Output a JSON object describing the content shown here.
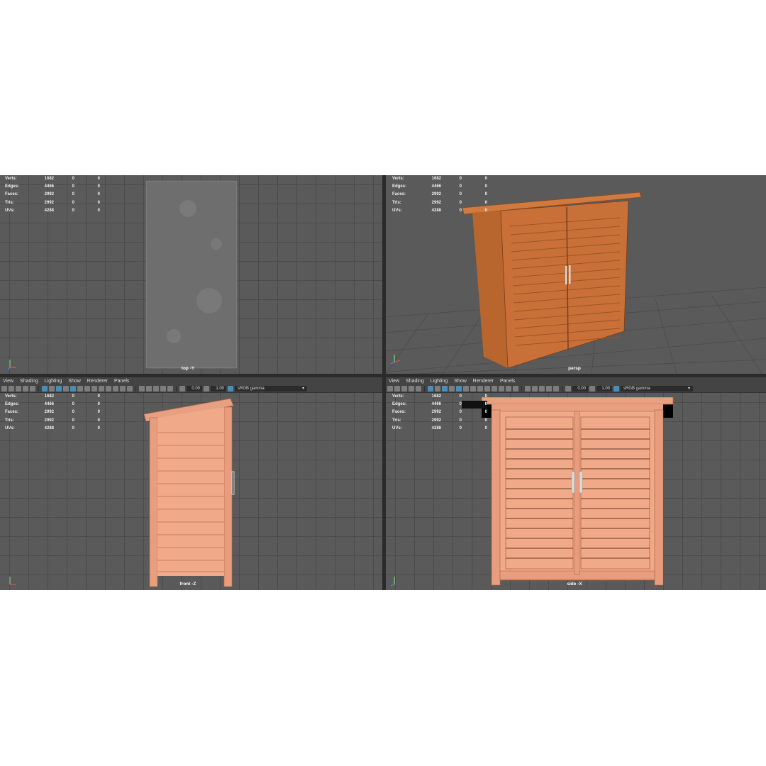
{
  "menu": [
    "View",
    "Shading",
    "Lighting",
    "Show",
    "Renderer",
    "Panels"
  ],
  "toolbar": {
    "exposure_value": "0.00",
    "gamma_value": "1.00",
    "color_space": "sRGB gamma",
    "icons": [
      "camera-icon",
      "camera-attr-icon",
      "bookmark-icon",
      "image-plane-icon",
      "grid-icon",
      "wireframe-icon",
      "smooth-shade-icon",
      "textured-icon",
      "lights-icon",
      "shadows-icon",
      "isolate-icon",
      "xray-icon",
      "exposure-icon",
      "gamma-icon",
      "color-space-icon"
    ]
  },
  "hud": {
    "labels": [
      "Verts:",
      "Edges:",
      "Faces:",
      "Tris:",
      "UVs:"
    ],
    "values": [
      [
        "1682",
        "0",
        "0"
      ],
      [
        "4466",
        "0",
        "0"
      ],
      [
        "2992",
        "0",
        "0"
      ],
      [
        "2992",
        "0",
        "0"
      ],
      [
        "4288",
        "0",
        "0"
      ]
    ]
  },
  "viewports": {
    "top": {
      "label": "top -Y"
    },
    "persp": {
      "label": "persp"
    },
    "front": {
      "label": "front -Z"
    },
    "side": {
      "label": "side -X"
    }
  },
  "colors": {
    "viewport_bg": "#5a5a5a",
    "grid_line": "#484848",
    "grid_axis": "#303030",
    "wood_light": "#f0a888",
    "wood_dark": "#c86c3c",
    "toolbar_bg": "#444444",
    "highlight": "#4a8db8"
  }
}
